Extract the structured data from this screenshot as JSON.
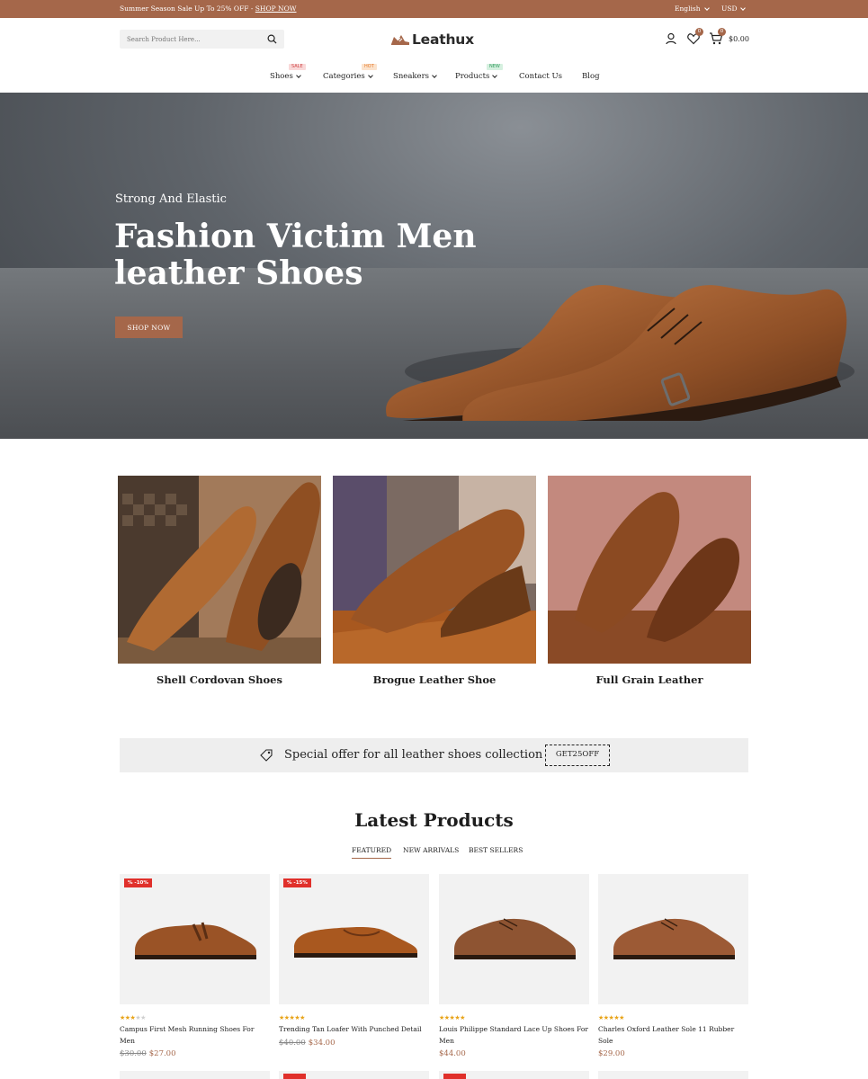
{
  "topbar": {
    "promo_text": "Summer Season Sale Up To 25% OFF - ",
    "promo_link": "SHOP NOW",
    "language": "English",
    "currency": "USD"
  },
  "header": {
    "search_placeholder": "Search Product Here...",
    "logo_text": "Leathux",
    "wishlist_count": "0",
    "cart_count": "0",
    "cart_total": "$0.00"
  },
  "nav": {
    "items": [
      {
        "label": "Shoes",
        "tag": "SALE"
      },
      {
        "label": "Categories",
        "tag": "HOT"
      },
      {
        "label": "Sneakers",
        "tag": ""
      },
      {
        "label": "Products",
        "tag": "NEW"
      },
      {
        "label": "Contact Us",
        "tag": ""
      },
      {
        "label": "Blog",
        "tag": ""
      }
    ]
  },
  "hero": {
    "subtitle": "Strong And Elastic",
    "title": "Fashion Victim Men leather Shoes",
    "button": "SHOP NOW"
  },
  "categories": [
    {
      "label": "Shell Cordovan Shoes"
    },
    {
      "label": "Brogue Leather Shoe"
    },
    {
      "label": "Full Grain Leather"
    }
  ],
  "offer": {
    "text": "Special offer for all leather shoes collection",
    "code": "GET25OFF"
  },
  "latest": {
    "title": "Latest Products",
    "tabs": [
      "FEATURED",
      "NEW ARRIVALS",
      "BEST SELLERS"
    ],
    "products": [
      {
        "name": "Campus First Mesh Running Shoes For Men",
        "old_price": "$30.00",
        "price": "$27.00",
        "discount": "% -10%",
        "rating": 3
      },
      {
        "name": "Trending Tan Loafer With Punched Detail",
        "old_price": "$40.00",
        "price": "$34.00",
        "discount": "% -15%",
        "rating": 5
      },
      {
        "name": "Louis Philippe Standard Lace Up Shoes For Men",
        "old_price": "",
        "price": "$44.00",
        "discount": "",
        "rating": 5
      },
      {
        "name": "Charles Oxford Leather Sole 11 Rubber Sole",
        "old_price": "",
        "price": "$29.00",
        "discount": "",
        "rating": 5
      }
    ]
  },
  "colors": {
    "accent": "#a5674a",
    "discount_badge": "#e0302b",
    "star": "#e8a317"
  }
}
